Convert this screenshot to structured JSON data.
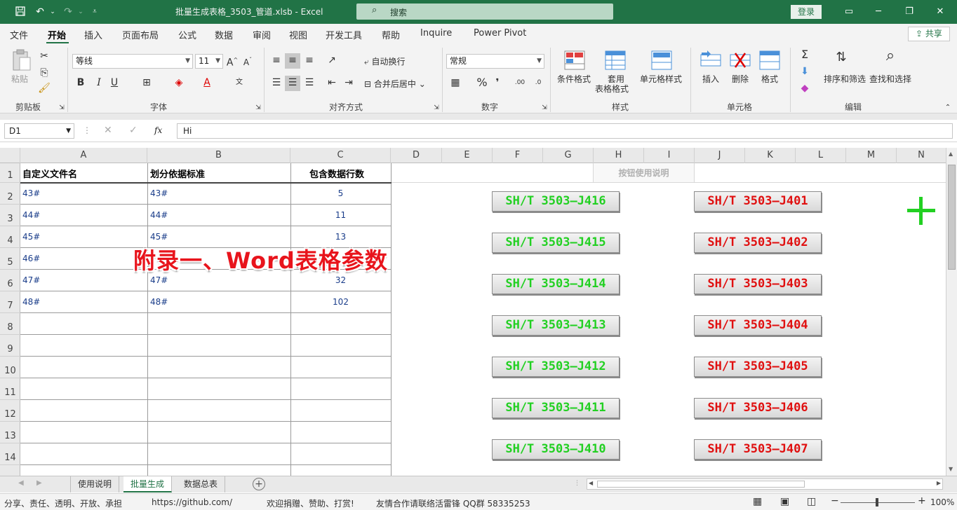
{
  "titlebar": {
    "title": "批量生成表格_3503_管道.xlsb  -  Excel",
    "search_placeholder": "搜索",
    "login": "登录"
  },
  "menu": {
    "tabs": [
      "文件",
      "开始",
      "插入",
      "页面布局",
      "公式",
      "数据",
      "审阅",
      "视图",
      "开发工具",
      "帮助",
      "Inquire",
      "Power Pivot"
    ],
    "active": "开始",
    "share": "共享"
  },
  "ribbon": {
    "clipboard": {
      "paste": "粘贴",
      "label": "剪贴板"
    },
    "font": {
      "name": "等线",
      "size": "11",
      "bold": "B",
      "italic": "I",
      "underline": "U",
      "label": "字体"
    },
    "alignment": {
      "wrap": "自动换行",
      "merge": "合并后居中",
      "label": "对齐方式"
    },
    "number": {
      "format": "常规",
      "percent": "%",
      "comma": "❜",
      "label": "数字"
    },
    "styles": {
      "conditional": "条件格式",
      "table1": "套用",
      "table2": "表格格式",
      "cell": "单元格样式",
      "label": "样式"
    },
    "cells": {
      "insert": "插入",
      "delete": "删除",
      "format": "格式",
      "label": "单元格"
    },
    "editing": {
      "sort": "排序和筛选",
      "find": "查找和选择",
      "label": "编辑"
    }
  },
  "formula_bar": {
    "name_box": "D1",
    "fx": "fx",
    "content": "Hi"
  },
  "columns": [
    "A",
    "B",
    "C",
    "D",
    "E",
    "F",
    "G",
    "H",
    "I",
    "J",
    "K",
    "L",
    "M",
    "N"
  ],
  "rows": [
    "1",
    "2",
    "3",
    "4",
    "5",
    "6",
    "7",
    "8",
    "9",
    "10",
    "11",
    "12",
    "13",
    "14"
  ],
  "table": {
    "headers": [
      "自定义文件名",
      "划分依据标准",
      "包含数据行数"
    ],
    "rows": [
      {
        "a": "43#",
        "b": "43#",
        "c": "5"
      },
      {
        "a": "44#",
        "b": "44#",
        "c": "11"
      },
      {
        "a": "45#",
        "b": "45#",
        "c": "13"
      },
      {
        "a": "46#",
        "b": "",
        "c": ""
      },
      {
        "a": "47#",
        "b": "47#",
        "c": "32"
      },
      {
        "a": "48#",
        "b": "48#",
        "c": "102"
      }
    ]
  },
  "usage_button": "按钮使用说明",
  "buttons_left": [
    "SH/T  3503—J416",
    "SH/T  3503—J415",
    "SH/T  3503—J414",
    "SH/T  3503—J413",
    "SH/T  3503—J412",
    "SH/T  3503—J411",
    "SH/T  3503—J410"
  ],
  "buttons_right": [
    "SH/T  3503—J401",
    "SH/T  3503—J402",
    "SH/T  3503—J403",
    "SH/T  3503—J404",
    "SH/T  3503—J405",
    "SH/T  3503—J406",
    "SH/T  3503—J407"
  ],
  "overlay_text": "附录一、Word表格参数",
  "colors": {
    "brand": "#217346",
    "green_button_text": "#22d022",
    "red_button_text": "#e01010"
  },
  "sheet_tabs": [
    "使用说明",
    "批量生成",
    "数据总表"
  ],
  "active_sheet": "批量生成",
  "statusbar": {
    "s1": "分享、责任、透明、开放、承担",
    "s2": "https://github.com/",
    "s3": "欢迎捐赠、赞助、打赏!",
    "s4": "友情合作请联络活雷锋 QQ群 58335253",
    "zoom": "100%"
  }
}
